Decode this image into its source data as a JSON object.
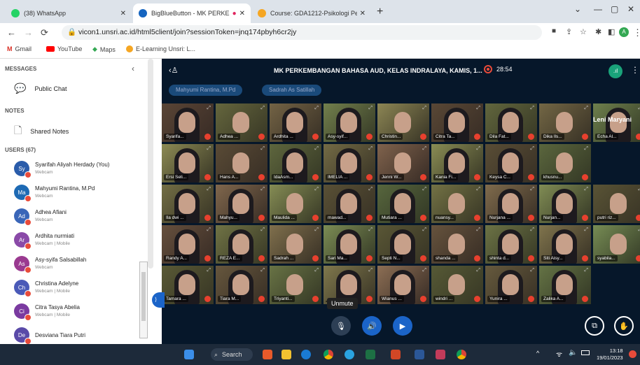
{
  "browser": {
    "tabs": [
      {
        "title": "(38) WhatsApp",
        "active": false,
        "color": "#25d366"
      },
      {
        "title": "BigBlueButton - MK PERKEM",
        "active": true,
        "color": "#1565c0"
      },
      {
        "title": "Course: GDA1212-Psikologi Perk",
        "active": false,
        "color": "#f5a623"
      }
    ],
    "url": "vicon1.unsri.ac.id/html5client/join?sessionToken=jnq174pbyh6cr2jy",
    "bookmarks": [
      "Gmail",
      "YouTube",
      "Maps",
      "E-Learning Unsri: L..."
    ]
  },
  "sidebar": {
    "messages_heading": "MESSAGES",
    "public_chat": "Public Chat",
    "notes_heading": "NOTES",
    "shared_notes": "Shared Notes",
    "users_heading": "USERS (67)",
    "users": [
      {
        "initials": "Sy",
        "name": "Syarifah Aliyah Herdady (You)",
        "sub": "Webcam",
        "color": "#2a5caa"
      },
      {
        "initials": "Ma",
        "name": "Mahyumi Rantina, M.Pd",
        "sub": "Webcam",
        "color": "#1e6ab4"
      },
      {
        "initials": "Ad",
        "name": "Adhea Afiani",
        "sub": "Webcam",
        "color": "#3a66b8"
      },
      {
        "initials": "Ar",
        "name": "Ardhita nurmiati",
        "sub": "Webcam | Mobile",
        "color": "#8a4aa8"
      },
      {
        "initials": "As",
        "name": "Asy-syifa Salsabillah",
        "sub": "Webcam",
        "color": "#9a3a90"
      },
      {
        "initials": "Ch",
        "name": "Christina Adelyne",
        "sub": "Webcam | Mobile",
        "color": "#4a5ab8"
      },
      {
        "initials": "Ci",
        "name": "Citra Tasya Abelia",
        "sub": "Webcam | Mobile",
        "color": "#7a3aa0"
      },
      {
        "initials": "De",
        "name": "Desviana Tiara Putri",
        "sub": "",
        "color": "#5a4aa8"
      }
    ]
  },
  "meeting": {
    "title": "MK PERKEMBANGAN BAHASA AUD, KELAS INDRALAYA, KAMIS, 1...",
    "timer": "28:54",
    "presenters": [
      "Mahyumi Rantina, M.Pd",
      "Sadrah As Satillah"
    ],
    "tiles": [
      "Syarifa...",
      "Adhea ...",
      "Ardhita ...",
      "Asy-syif...",
      "Christin...",
      "Citra Ta...",
      "Dila Fat...",
      "Dika Ils...",
      "Echa Al...",
      "Ersi Seli...",
      "Hans A...",
      "IdaAsm...",
      "IMELIA ...",
      "Jenni W...",
      "Kania Fi...",
      "Keysa C...",
      "khusnu...",
      "Ila dwi ...",
      "Mahyu...",
      "Maulida ...",
      "mawad...",
      "Mutiara ...",
      "nuansy...",
      "Nurjana ...",
      "Nurjan...",
      "putri riz...",
      "Randy A...",
      "REZA E...",
      "Sadrah ...",
      "Sari Ma...",
      "Septi N...",
      "shanda ...",
      "shinta d...",
      "Siti Aisy...",
      "syabila...",
      "Tamara ...",
      "Tiara M...",
      "Triyanti...",
      "",
      "Wianus ...",
      "windri ...",
      "Yunira ...",
      "Zalika A..."
    ],
    "leni": "Leni Maryani",
    "tooltip": "Unmute"
  },
  "taskbar": {
    "search": "Search",
    "time": "13:18",
    "date": "19/01/2023"
  }
}
